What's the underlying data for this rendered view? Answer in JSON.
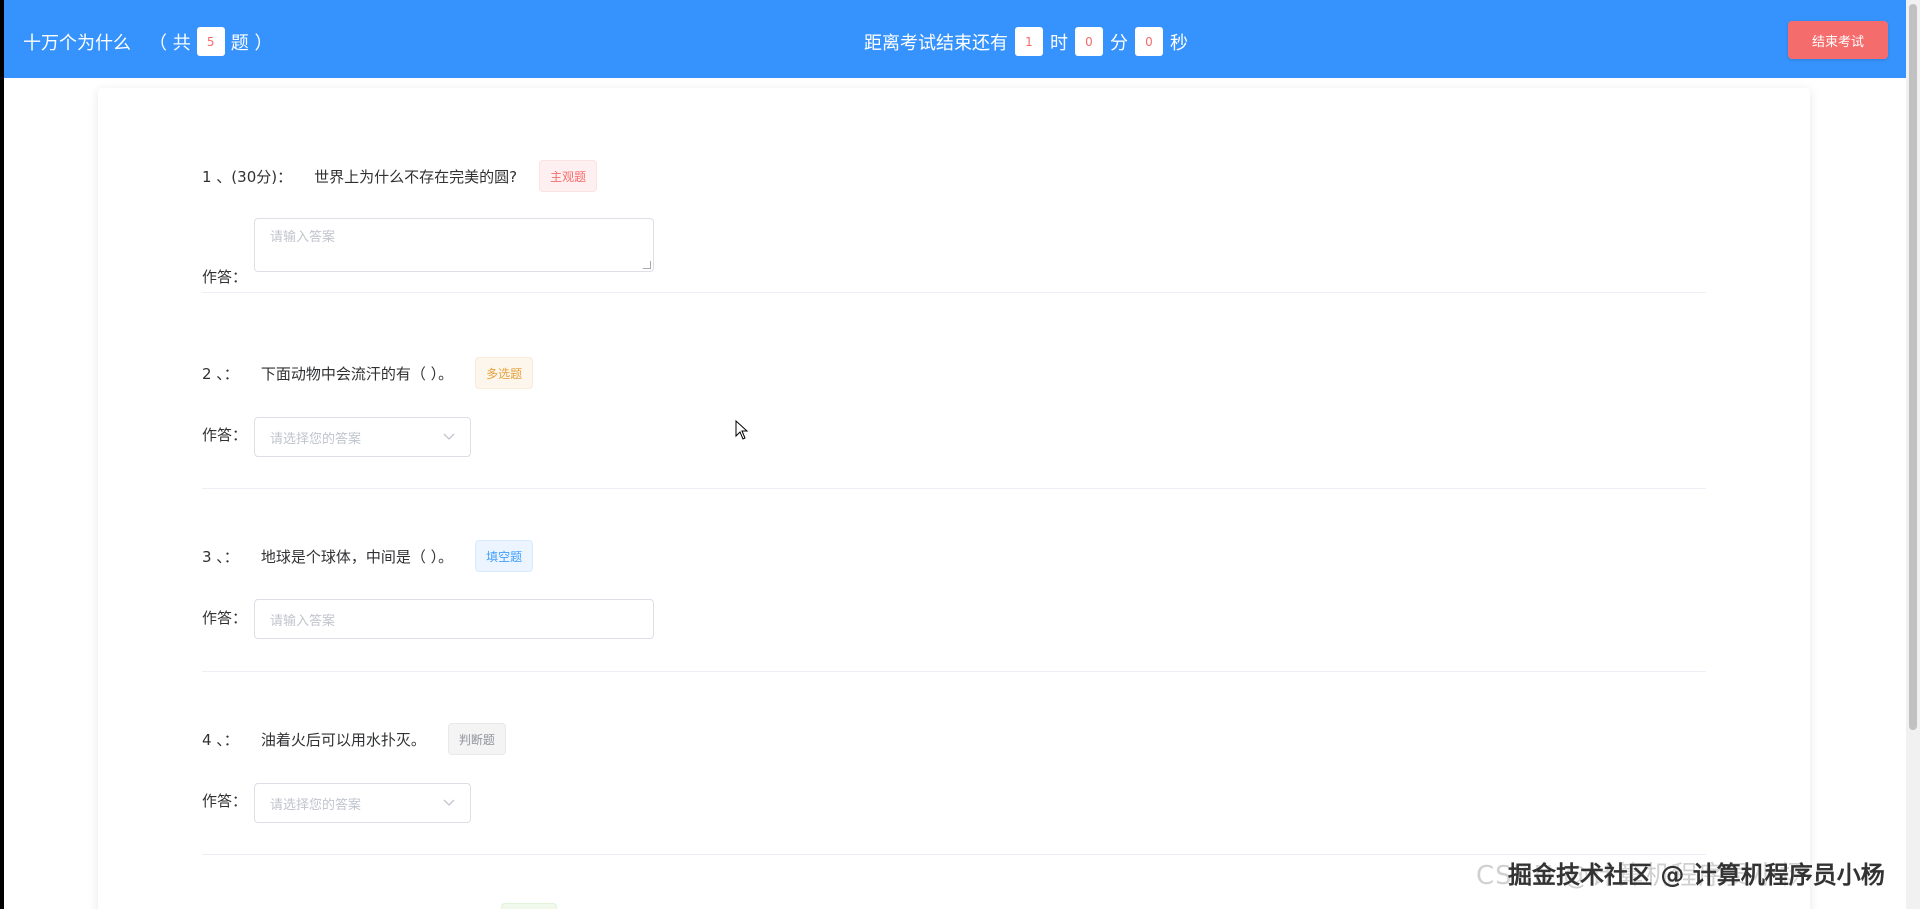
{
  "header": {
    "title": "十万个为什么",
    "count_prefix": "（ 共",
    "count": "5",
    "count_suffix": "题 ）",
    "timer_prefix": "距离考试结束还有",
    "hours": "1",
    "hours_unit": "时",
    "minutes": "0",
    "minutes_unit": "分",
    "seconds": "0",
    "seconds_unit": "秒",
    "end_button": "结束考试"
  },
  "questions": [
    {
      "no": "1 、(30分)：",
      "text": "世界上为什么不存在完美的圆?",
      "tag": "主观题",
      "answer_label": "作答：",
      "placeholder": "请输入答案"
    },
    {
      "no": "2 、：",
      "text": "下面动物中会流汗的有（ ）。",
      "tag": "多选题",
      "answer_label": "作答：",
      "placeholder": "请选择您的答案"
    },
    {
      "no": "3 、：",
      "text": "地球是个球体，中间是（ ）。",
      "tag": "填空题",
      "answer_label": "作答：",
      "placeholder": "请输入答案"
    },
    {
      "no": "4 、：",
      "text": "油着火后可以用水扑灭。",
      "tag": "判断题",
      "answer_label": "作答：",
      "placeholder": "请选择您的答案"
    }
  ],
  "watermark": "掘金技术社区 @ 计算机程序员小杨",
  "watermark_bg": "CSDN @计算机程序员小杨",
  "colors": {
    "header": "#3693fd",
    "danger": "#f56c6c"
  }
}
